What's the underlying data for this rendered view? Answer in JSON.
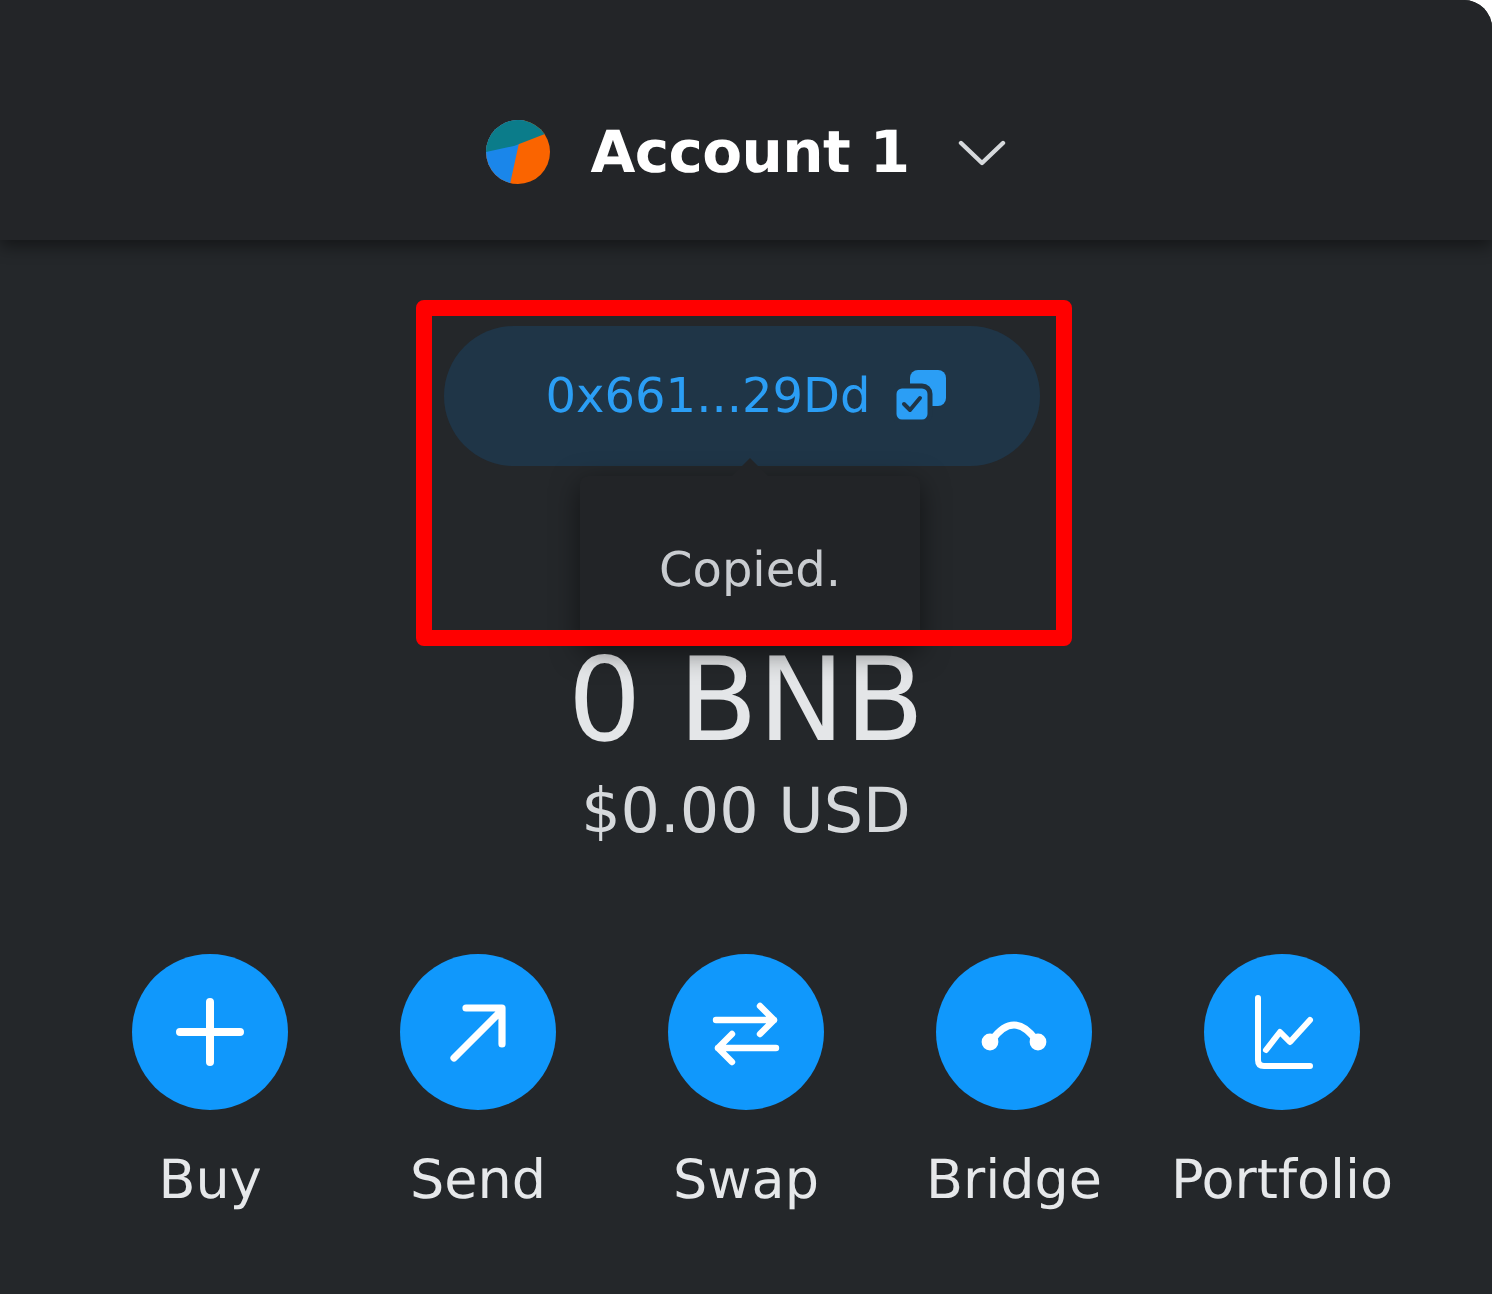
{
  "header": {
    "account_name": "Account 1"
  },
  "address": {
    "text": "0x661...29Dd",
    "highlighted": true
  },
  "tooltip": {
    "text": "Copied."
  },
  "balance": {
    "amount": "0 BNB",
    "fiat": "$0.00 USD"
  },
  "actions": [
    {
      "kind": "buy",
      "label": "Buy"
    },
    {
      "kind": "send",
      "label": "Send"
    },
    {
      "kind": "swap",
      "label": "Swap"
    },
    {
      "kind": "bridge",
      "label": "Bridge"
    },
    {
      "kind": "portfolio",
      "label": "Portfolio"
    }
  ]
}
